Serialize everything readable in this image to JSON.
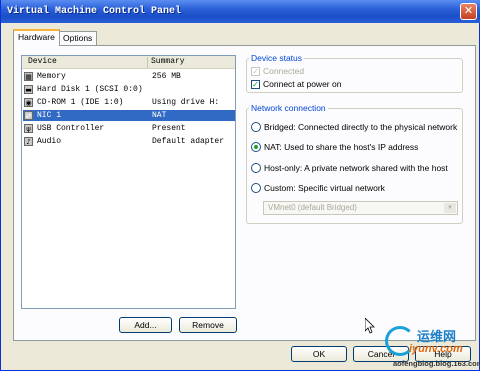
{
  "window": {
    "title": "Virtual Machine Control Panel",
    "close_glyph": "✕"
  },
  "tabs": [
    {
      "label": "Hardware"
    },
    {
      "label": "Options"
    }
  ],
  "device_list": {
    "headers": {
      "device": "Device",
      "summary": "Summary"
    },
    "rows": [
      {
        "device": "Memory",
        "summary": "256 MB",
        "icon": "memory-icon",
        "glyph": "▦"
      },
      {
        "device": "Hard Disk 1 (SCSI 0:0)",
        "summary": "",
        "icon": "hard-disk-icon",
        "glyph": "▬"
      },
      {
        "device": "CD-ROM 1 (IDE 1:0)",
        "summary": "Using drive H:",
        "icon": "cdrom-icon",
        "glyph": "◉"
      },
      {
        "device": "NIC 1",
        "summary": "NAT",
        "icon": "network-adapter-icon",
        "glyph": "⇄"
      },
      {
        "device": "USB Controller",
        "summary": "Present",
        "icon": "usb-icon",
        "glyph": "ψ"
      },
      {
        "device": "Audio",
        "summary": "Default adapter",
        "icon": "audio-icon",
        "glyph": "♪"
      }
    ],
    "selected_index": 3
  },
  "buttons": {
    "add": "Add...",
    "remove": "Remove",
    "ok": "OK",
    "cancel": "Cancel",
    "help": "Help"
  },
  "device_status": {
    "title": "Device status",
    "connected": {
      "label": "Connected",
      "checked": true,
      "disabled": true
    },
    "connect_power_on": {
      "label": "Connect at power on",
      "checked": true
    }
  },
  "network_connection": {
    "title": "Network connection",
    "options": [
      {
        "label": "Bridged: Connected directly to the physical network",
        "selected": false
      },
      {
        "label": "NAT: Used to share the host's IP address",
        "selected": true
      },
      {
        "label": "Host-only: A private network shared with the host",
        "selected": false
      },
      {
        "label": "Custom: Specific virtual network",
        "selected": false
      }
    ],
    "vmnet_select": "VMnet0 (default Bridged)"
  },
  "watermark": {
    "cn": "运维网",
    "en": "iyunv.com",
    "url": "aofengblog.blog.163.com"
  },
  "colors": {
    "accent": "#316ac5",
    "title_bar": "#2a5fd8",
    "group_label": "#0046d5"
  }
}
